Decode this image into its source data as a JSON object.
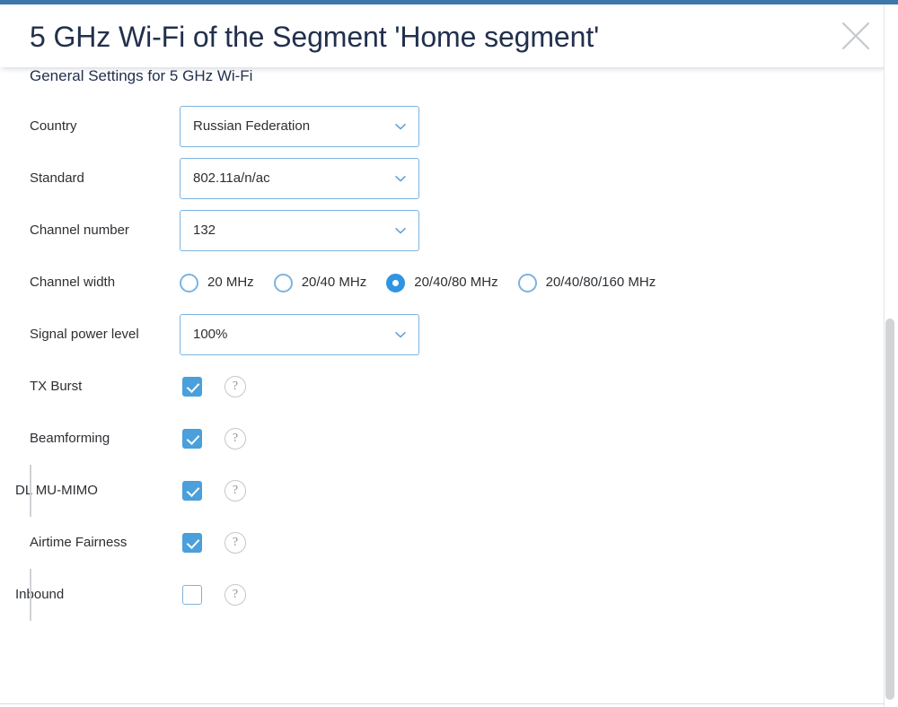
{
  "dialog": {
    "title": "5 GHz Wi-Fi of the Segment 'Home segment'",
    "close_icon": "close-icon",
    "section_heading": "General Settings for 5 GHz Wi-Fi",
    "accent_color": "#3c78ab",
    "title_color": "#22304d"
  },
  "help_icon_glyph": "?",
  "fields": {
    "country": {
      "label": "Country",
      "value": "Russian Federation"
    },
    "standard": {
      "label": "Standard",
      "value": "802.11a/n/ac"
    },
    "channel_number": {
      "label": "Channel number",
      "value": "132"
    },
    "channel_width": {
      "label": "Channel width",
      "options": [
        {
          "label": "20 MHz",
          "selected": false
        },
        {
          "label": "20/40 MHz",
          "selected": false
        },
        {
          "label": "20/40/80 MHz",
          "selected": true
        },
        {
          "label": "20/40/80/160 MHz",
          "selected": false
        }
      ]
    },
    "signal_power_level": {
      "label": "Signal power level",
      "value": "100%"
    },
    "tx_burst": {
      "label": "TX Burst",
      "checked": true
    },
    "beamforming": {
      "label": "Beamforming",
      "checked": true
    },
    "dl_mu_mimo": {
      "label": "DL MU-MIMO",
      "checked": true,
      "indented": true
    },
    "airtime_fairness": {
      "label": "Airtime Fairness",
      "checked": true
    },
    "inbound": {
      "label": "Inbound",
      "checked": false,
      "indented": true
    }
  },
  "colors": {
    "checkbox_checked": "#4b9fdb",
    "radio_selected": "#2f95e0",
    "field_border": "#7cb3e0",
    "scrollbar_thumb": "#d2d4d6"
  }
}
